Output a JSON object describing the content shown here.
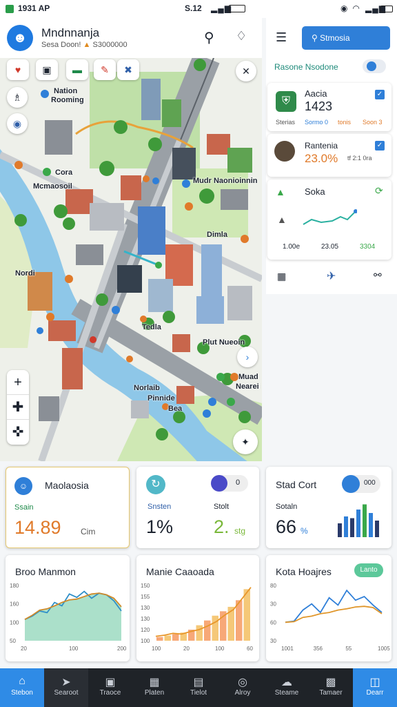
{
  "status_bar": {
    "left": "1931 AP",
    "center": "S.12",
    "right_icons": [
      "wifi-icon",
      "signal-icon",
      "battery-icon"
    ]
  },
  "header": {
    "title": "Mndnnanja",
    "subtitle": "Sesa Doon!",
    "subtitle_value": "S3000000"
  },
  "map": {
    "labels": {
      "nation": "Nation",
      "rooming": "Rooming",
      "cora": "Cora",
      "manoasoil": "Mcmaosoil",
      "nordi": "Nordi",
      "mudr": "Mudr Naonioinnin",
      "dimla": "Dimla",
      "tedla": "Tedla",
      "plut": "Plut Nueoin",
      "norlaib": "Norlaib",
      "muad": "Muad",
      "nearei": "Nearei",
      "plenide": "Pinnide",
      "bea": "Bea"
    }
  },
  "right_panel": {
    "search_label": "Stmosia",
    "section_title": "Rasone Nsodone",
    "items": [
      {
        "name": "Aacia",
        "value": "1423",
        "meta_left": "Sterias",
        "meta_mid": "Sormo 0",
        "meta_tag": "tonis",
        "meta_right": "Soon 3"
      },
      {
        "name": "Rantenia",
        "value": "23.0%",
        "meta_right": "tf 2:1 0ra"
      },
      {
        "name": "Soka",
        "stats": [
          "1.00e",
          "23.05",
          "3304"
        ]
      }
    ]
  },
  "cards": {
    "c1": {
      "title": "Maolaosia",
      "label": "Ssain",
      "value": "14.89",
      "unit": "Cim"
    },
    "c2": {
      "label1": "Snsten",
      "value1": "1%",
      "label2": "Stolt",
      "value2": "2.",
      "unit2": "stg",
      "pill": "0"
    },
    "c3": {
      "title": "Stad Cort",
      "label": "Sotaln",
      "value": "66",
      "unit": "%",
      "pill": "000"
    },
    "c4": {
      "title": "Broo Manmon",
      "yticks": [
        "180",
        "160",
        "100",
        "50"
      ],
      "xticks": [
        "20",
        "100",
        "200"
      ]
    },
    "c5": {
      "title": "Manie Caaoada",
      "yticks": [
        "150",
        "155",
        "130",
        "130",
        "120",
        "100"
      ],
      "xticks": [
        "100",
        "20",
        "100",
        "60"
      ]
    },
    "c6": {
      "title": "Kota Hoajres",
      "badge": "Lanto",
      "yticks": [
        "80",
        "30",
        "60",
        "30"
      ],
      "xticks": [
        "1001",
        "356",
        "55",
        "1005"
      ]
    }
  },
  "chart_data": [
    {
      "type": "area",
      "title": "Broo Manmon",
      "series": [
        {
          "values": [
            50,
            58,
            70,
            66,
            90,
            82,
            110,
            102,
            116,
            100,
            112,
            108,
            94,
            70
          ]
        },
        {
          "values": [
            50,
            60,
            72,
            75,
            82,
            90,
            96,
            98,
            104,
            110,
            112,
            108,
            100,
            80
          ]
        }
      ]
    },
    {
      "type": "bar",
      "title": "Manie Caaoada",
      "values": [
        10,
        14,
        18,
        22,
        30,
        42,
        55,
        68,
        80,
        92,
        110,
        140
      ],
      "line": [
        12,
        15,
        20,
        18,
        25,
        30,
        40,
        52,
        70,
        85,
        115,
        145
      ]
    },
    {
      "type": "line",
      "title": "Kota Hoajres",
      "series": [
        {
          "values": [
            30,
            32,
            50,
            60,
            46,
            70,
            58,
            82,
            66,
            72,
            58,
            46
          ]
        },
        {
          "values": [
            30,
            31,
            38,
            40,
            44,
            46,
            50,
            52,
            55,
            56,
            54,
            44
          ]
        }
      ]
    },
    {
      "type": "bar",
      "title": "Stad Cort",
      "values": [
        40,
        60,
        55,
        80,
        95,
        70,
        48
      ]
    }
  ],
  "nav": [
    {
      "label": "Stebon",
      "icon": "home-icon",
      "active": true
    },
    {
      "label": "Searoot",
      "icon": "send-icon"
    },
    {
      "label": "Traoce",
      "icon": "save-icon"
    },
    {
      "label": "Platen",
      "icon": "map-icon"
    },
    {
      "label": "Tielot",
      "icon": "panel-icon"
    },
    {
      "label": "Alroy",
      "icon": "compass-icon"
    },
    {
      "label": "Steame",
      "icon": "cloud-icon"
    },
    {
      "label": "Tamaer",
      "icon": "calendar-icon"
    },
    {
      "label": "Dearr",
      "icon": "bag-icon",
      "highlight": true
    }
  ]
}
